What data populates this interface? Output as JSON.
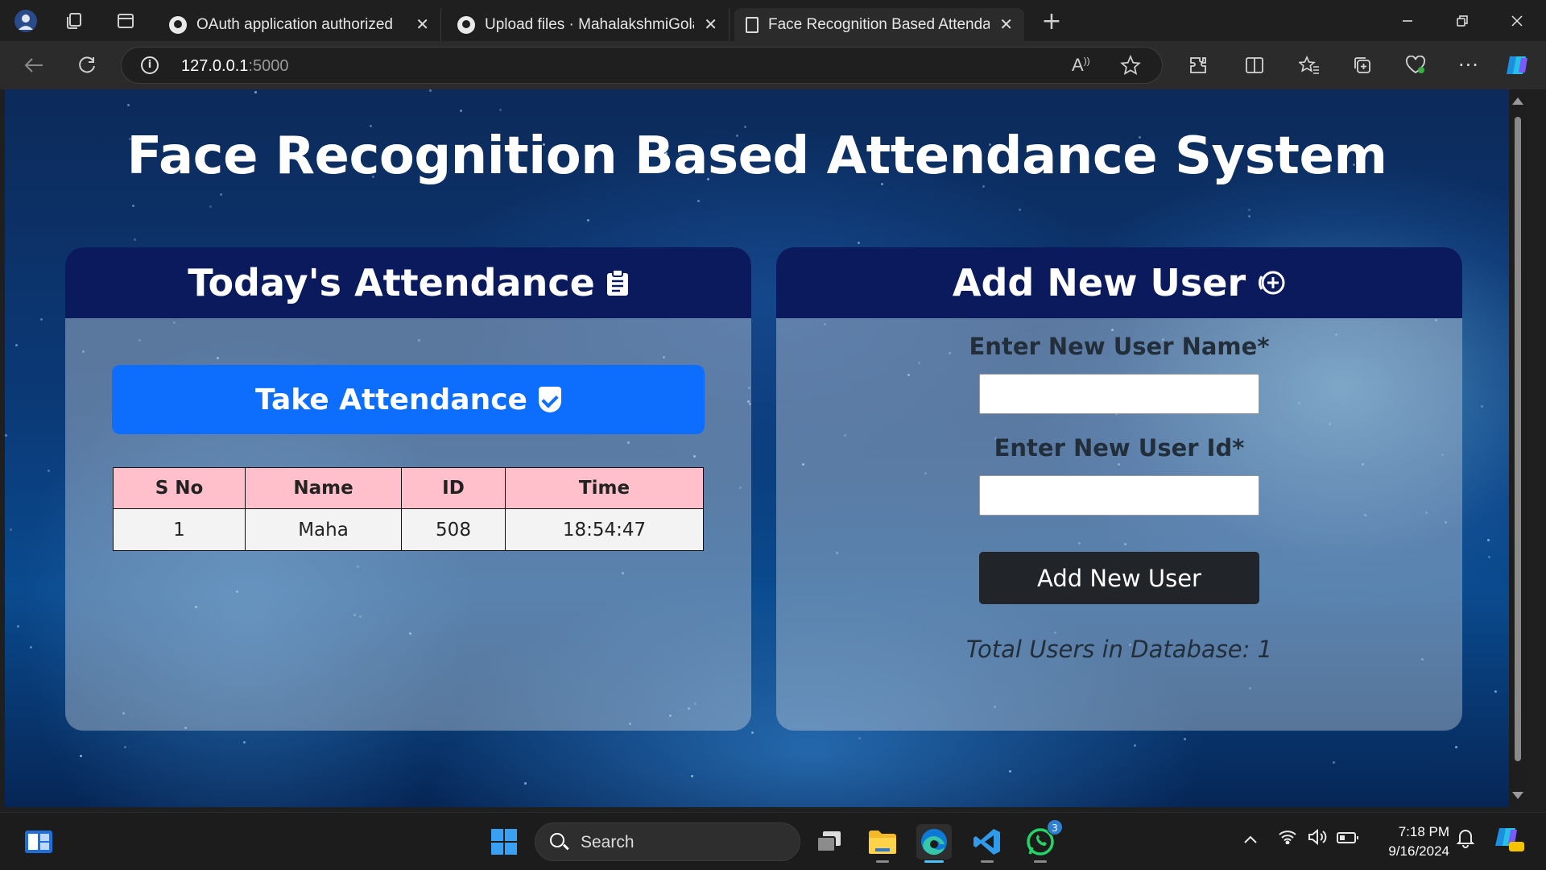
{
  "browser": {
    "tabs": [
      {
        "title": "OAuth application authorized",
        "close": "✕",
        "icon": "github-icon"
      },
      {
        "title": "Upload files · MahalakshmiGolakonda",
        "close": "✕",
        "icon": "github-icon"
      },
      {
        "title": "Face Recognition Based Attendance System",
        "close": "✕",
        "icon": "page-icon",
        "active": true
      }
    ],
    "new_tab": "+",
    "url": {
      "host": "127.0.0.1",
      "port": ":5000"
    }
  },
  "page": {
    "title": "Face Recognition Based Attendance System",
    "attendance": {
      "heading": "Today's Attendance",
      "button_label": "Take Attendance",
      "columns": [
        "S No",
        "Name",
        "ID",
        "Time"
      ],
      "rows": [
        {
          "sno": "1",
          "name": "Maha",
          "id": "508",
          "time": "18:54:47"
        }
      ]
    },
    "add_user": {
      "heading": "Add New User",
      "name_label": "Enter New User Name*",
      "name_value": "",
      "id_label": "Enter New User Id*",
      "id_value": "",
      "button_label": "Add New User",
      "total_text": "Total Users in Database: 1"
    }
  },
  "taskbar": {
    "search_placeholder": "Search",
    "time": "7:18 PM",
    "date": "9/16/2024",
    "whatsapp_badge": "3"
  },
  "colors": {
    "card_header": "#0b1a5c",
    "primary_button": "#0d6efd",
    "dark_button": "#212529",
    "table_header": "#ffc0cb"
  }
}
